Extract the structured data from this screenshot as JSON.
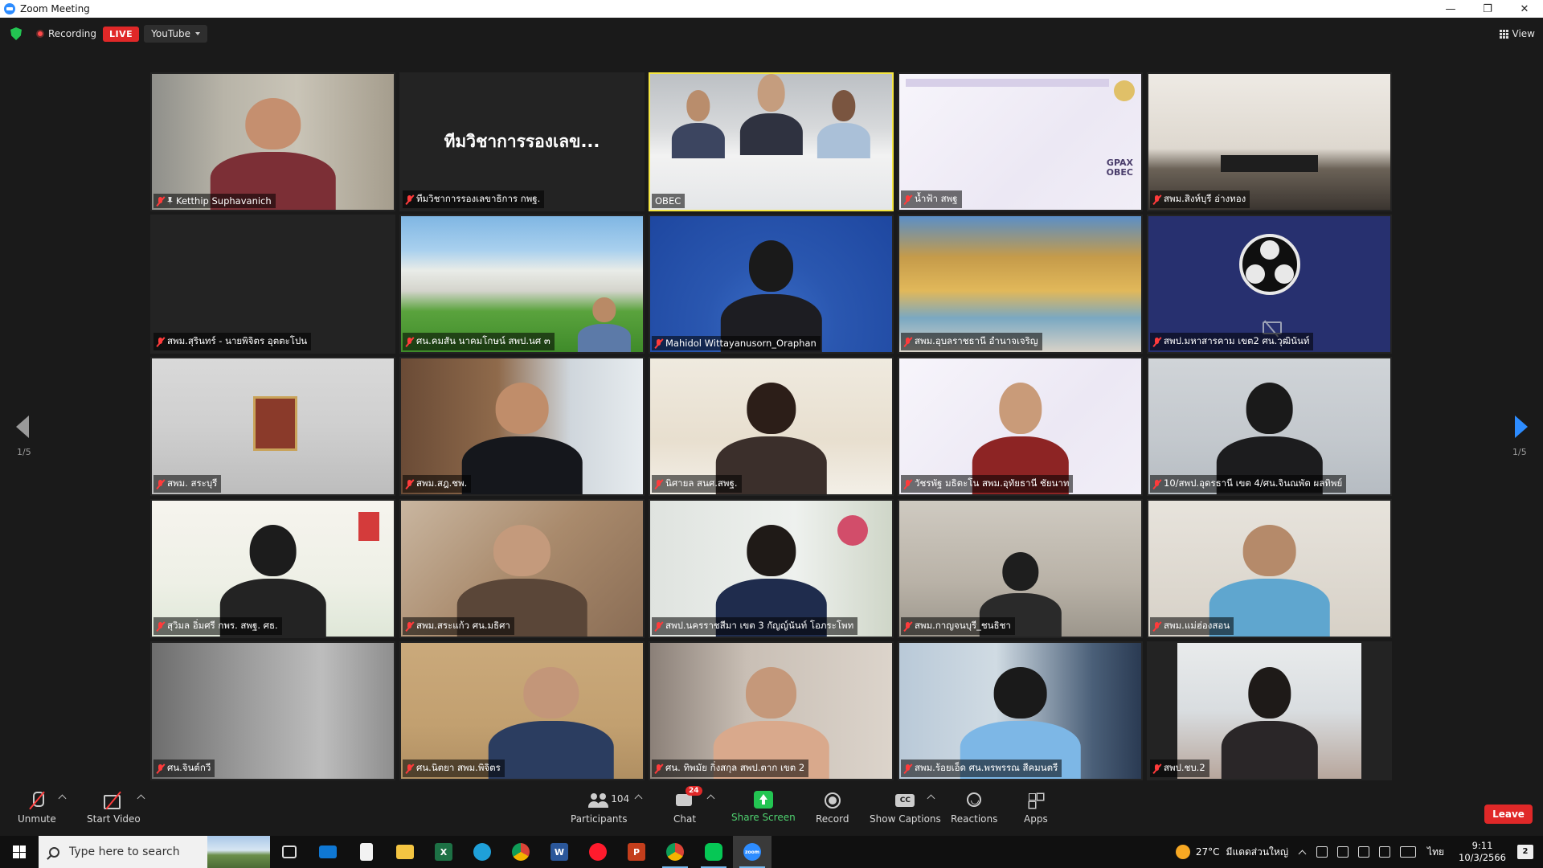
{
  "window": {
    "title": "Zoom Meeting",
    "controls": [
      "—",
      "❐",
      "✕"
    ]
  },
  "topbar": {
    "recording_label": "Recording",
    "live_label": "LIVE",
    "stream_target": "YouTube",
    "view_label": "View"
  },
  "gallery": {
    "page_indicator_left": "1/5",
    "page_indicator_right": "1/5",
    "tiles": [
      {
        "name": "Ketthip Suphavanich",
        "muted": true,
        "pinned": true
      },
      {
        "name": "ทีมวิชาการรองเลขาธิการ กพฐ.",
        "muted": true,
        "display_text": "ทีมวิชาการรองเลข..."
      },
      {
        "name": "OBEC",
        "muted": false,
        "active_speaker": true
      },
      {
        "name": "น้ำฟ้า สพฐ",
        "muted": true
      },
      {
        "name": "สพม.สิงห์บุรี อ่างทอง",
        "muted": true
      },
      {
        "name": "สพม.สุรินทร์ - นายพิจิตร อุตตะโปน",
        "muted": true
      },
      {
        "name": "ศน.คมสัน นาคมโกษน์ สพป.นศ ๓",
        "muted": true
      },
      {
        "name": "Mahidol Wittayanusorn_Oraphan",
        "muted": true
      },
      {
        "name": "สพม.อุบลราชธานี อำนาจเจริญ",
        "muted": true
      },
      {
        "name": "สพป.มหาสารคาม เขต2  ศน.วุฒินันท์",
        "muted": true,
        "video_off": true
      },
      {
        "name": "สพม. สระบุรี",
        "muted": true
      },
      {
        "name": "สพม.สฎ.ชพ.",
        "muted": true
      },
      {
        "name": "นิศายล สนศ.สพฐ.",
        "muted": true
      },
      {
        "name": "วัชรพัฐ มธิตะโน สพม.อุทัยธานี ชัยนาท",
        "muted": true
      },
      {
        "name": "10/สพป.อุดรธานี เขต 4/ศน.จินณพัต ผลทิพย์",
        "muted": true
      },
      {
        "name": "สุวิมล อิ่มศรี กพร. สพฐ. ศธ.",
        "muted": true
      },
      {
        "name": "สพม.สระแก้ว ศน.มธิศา",
        "muted": true
      },
      {
        "name": "สพป.นครราชสีมา  เขต 3 กัญญ์นันท์  โอภระโพท",
        "muted": true
      },
      {
        "name": "สพม.กาญจนบุรี_ชนธิชา",
        "muted": true
      },
      {
        "name": "สพม.แม่ฮ่องสอน",
        "muted": true
      },
      {
        "name": "ศน.จินต์กวี",
        "muted": true
      },
      {
        "name": "ศน.นิตยา  สพม.พิจิตร",
        "muted": true
      },
      {
        "name": "ศน. ทิพมัย กิ่งสกุล สพป.ตาก เขต 2",
        "muted": true
      },
      {
        "name": "สพม.ร้อยเอ็ด ศน.พรพรรณ สีคมนตรี",
        "muted": true
      },
      {
        "name": "สพป.ชบ.2",
        "muted": true
      }
    ]
  },
  "toolbar": {
    "unmute": "Unmute",
    "start_video": "Start Video",
    "participants": "Participants",
    "participants_count": "104",
    "chat": "Chat",
    "chat_badge": "24",
    "share_screen": "Share Screen",
    "record": "Record",
    "show_captions": "Show Captions",
    "reactions": "Reactions",
    "apps": "Apps",
    "leave": "Leave"
  },
  "taskbar": {
    "search_placeholder": "Type here to search",
    "weather_temp": "27°C",
    "weather_desc": "มีแดดส่วนใหญ่",
    "language": "ไทย",
    "time": "9:11",
    "date": "10/3/2566",
    "notification_count": "2",
    "apps": [
      "task-view",
      "mail",
      "file",
      "explorer",
      "excel",
      "edge",
      "chrome",
      "word",
      "opera",
      "powerpoint",
      "chrome-profile",
      "line",
      "zoom"
    ]
  },
  "colors": {
    "accent": "#2d8cff",
    "active_speaker_border": "#f5e642",
    "live": "#e02828",
    "share_green": "#23c552"
  }
}
